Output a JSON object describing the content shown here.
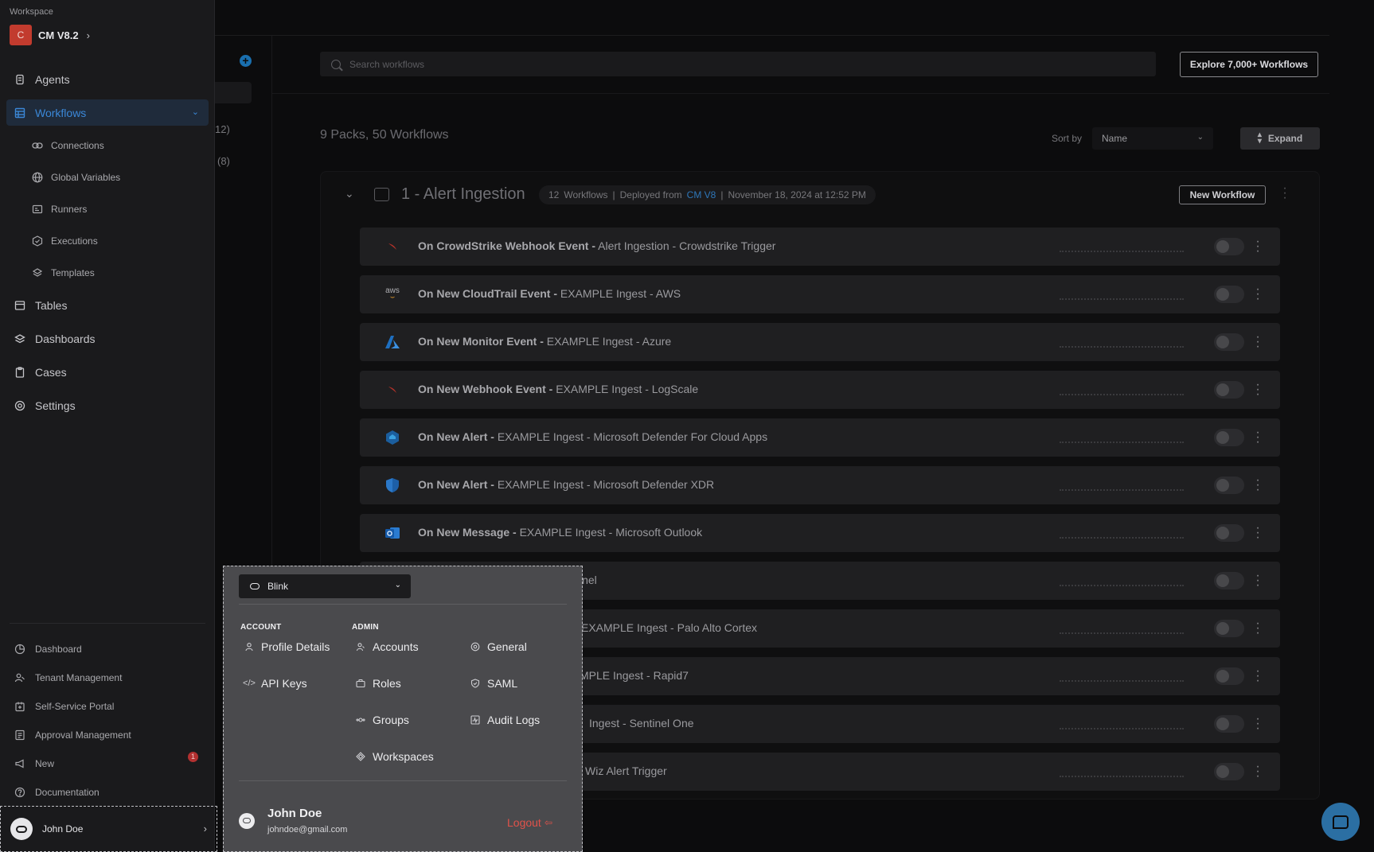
{
  "workspace": {
    "label": "Workspace",
    "avatar_letter": "C",
    "name": "CM V8.2"
  },
  "nav": {
    "agents": "Agents",
    "workflows": "Workflows",
    "connections": "Connections",
    "global_variables": "Global Variables",
    "runners": "Runners",
    "executions": "Executions",
    "templates": "Templates",
    "tables": "Tables",
    "dashboards": "Dashboards",
    "cases": "Cases",
    "settings": "Settings"
  },
  "footer_nav": {
    "dashboard": "Dashboard",
    "tenant_management": "Tenant Management",
    "self_service_portal": "Self-Service Portal",
    "approval_management": "Approval Management",
    "new": "New",
    "new_badge": "1",
    "documentation": "Documentation"
  },
  "user": {
    "name": "John Doe",
    "email": "johndoe@gmail.com"
  },
  "background": {
    "count_a": "12)",
    "count_b": "(8)",
    "search_placeholder": "Search workflows",
    "explore_label": "Explore 7,000+ Workflows",
    "summary": "9 Packs, 50 Workflows",
    "sort_label": "Sort by",
    "sort_value": "Name",
    "expand_label": "Expand",
    "pack": {
      "title": "1 - Alert Ingestion",
      "count": "12",
      "workflows_word": "Workflows",
      "deployed_from": "Deployed from",
      "source": "CM V8",
      "date": "November 18, 2024 at 12:52 PM",
      "new_workflow_label": "New Workflow"
    },
    "rows": [
      {
        "trigger": "On CrowdStrike Webhook Event -",
        "name": "Alert Ingestion - Crowdstrike Trigger",
        "icon": "crowdstrike-icon"
      },
      {
        "trigger": "On New CloudTrail Event -",
        "name": "EXAMPLE Ingest - AWS",
        "icon": "aws-icon"
      },
      {
        "trigger": "On New Monitor Event -",
        "name": "EXAMPLE Ingest - Azure",
        "icon": "azure-icon"
      },
      {
        "trigger": "On New Webhook Event -",
        "name": "EXAMPLE Ingest - LogScale",
        "icon": "crowdstrike-icon"
      },
      {
        "trigger": "On New Alert -",
        "name": "EXAMPLE Ingest - Microsoft Defender For Cloud Apps",
        "icon": "defender-cloud-icon"
      },
      {
        "trigger": "On New Alert -",
        "name": "EXAMPLE Ingest - Microsoft Defender XDR",
        "icon": "defender-shield-icon"
      },
      {
        "trigger": "On New Message -",
        "name": "EXAMPLE Ingest - Microsoft Outlook",
        "icon": "outlook-icon"
      },
      {
        "partial": "inel"
      },
      {
        "partial": "EXAMPLE Ingest - Palo Alto Cortex"
      },
      {
        "partial": "MPLE Ingest - Rapid7"
      },
      {
        "partial": "Ingest - Sentinel One"
      },
      {
        "partial": "Wiz Alert Trigger"
      }
    ]
  },
  "popup": {
    "tenant": "Blink",
    "account_label": "ACCOUNT",
    "admin_label": "ADMIN",
    "profile_details": "Profile Details",
    "api_keys": "API Keys",
    "accounts": "Accounts",
    "roles": "Roles",
    "groups": "Groups",
    "workspaces": "Workspaces",
    "general": "General",
    "saml": "SAML",
    "audit_logs": "Audit Logs",
    "logout": "Logout"
  },
  "colors": {
    "accent_blue": "#3b88d8",
    "logout_red": "#e0524a",
    "workspace_red": "#c23b2e"
  }
}
